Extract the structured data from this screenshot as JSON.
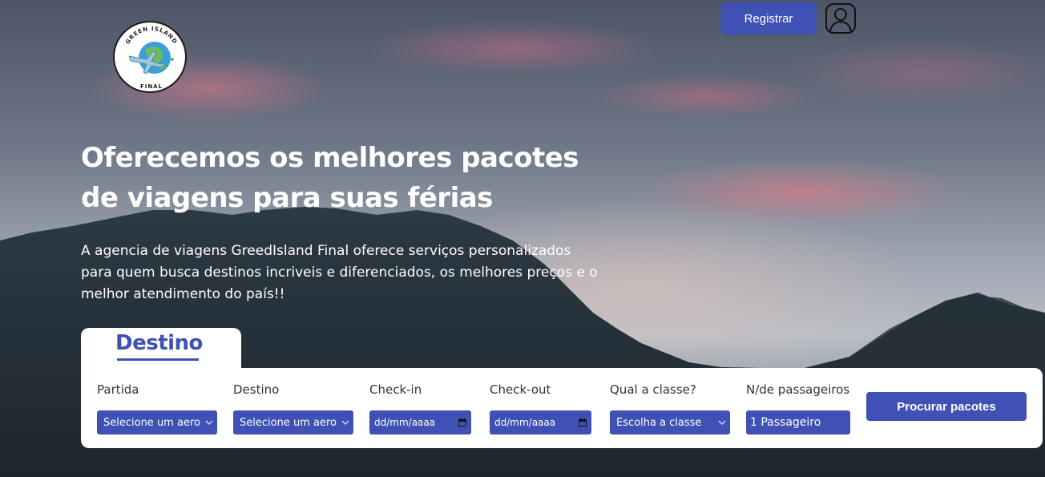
{
  "header": {
    "logo": {
      "top_text": "GREEN ISLAND",
      "bottom_text": "FINAL",
      "icon": "globe-airplane-logo"
    },
    "register_label": "Registrar",
    "user_icon": "user-icon"
  },
  "hero": {
    "headline_line1": "Oferecemos os melhores pacotes",
    "headline_line2": "de viagens para suas férias",
    "subtext_line1": "A agencia de viagens GreedIsland Final oferece serviços personalizados",
    "subtext_line2": "para quem busca destinos incriveis e diferenciados, os melhores preços e o",
    "subtext_line3": "melhor atendimento do país!!"
  },
  "search": {
    "tab_label": "Destino",
    "fields": {
      "partida": {
        "label": "Partida",
        "value": "Selecione um aeroporto"
      },
      "destino": {
        "label": "Destino",
        "value": "Selecione um aeroporto"
      },
      "checkin": {
        "label": "Check-in",
        "value": "dd/mm/aaaa"
      },
      "checkout": {
        "label": "Check-out",
        "value": "dd/mm/aaaa"
      },
      "classe": {
        "label": "Qual a classe?",
        "value": "Escolha a classe"
      },
      "passageiros": {
        "label": "N/de passageiros",
        "value": "1 Passageiro"
      }
    },
    "submit_label": "Procurar pacotes"
  },
  "colors": {
    "accent": "#3f51b5",
    "panel": "#ffffff",
    "text_light": "#ffffff"
  }
}
